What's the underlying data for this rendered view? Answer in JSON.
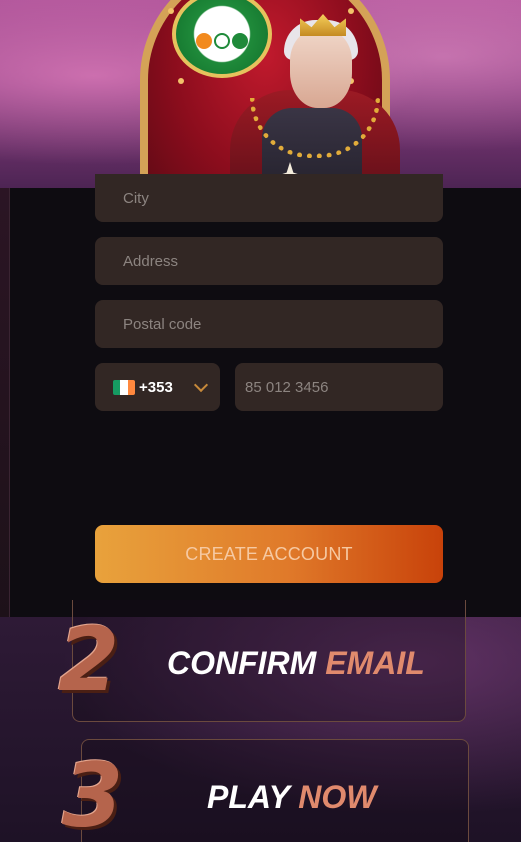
{
  "form": {
    "city_placeholder": "City",
    "address_placeholder": "Address",
    "postal_placeholder": "Postal code",
    "country": {
      "flag": "ireland-flag-icon",
      "dial_code": "+353"
    },
    "phone_placeholder": "85 012 3456",
    "create_account_label": "CREATE ACCOUNT"
  },
  "steps": [
    {
      "number": "2",
      "title_white": "CONFIRM",
      "title_accent": "EMAIL"
    },
    {
      "number": "3",
      "title_white": "PLAY",
      "title_accent": "NOW"
    }
  ],
  "colors": {
    "field_bg": "#322724",
    "panel_bg": "#0e0c11",
    "button_gradient_start": "#e8a23c",
    "button_gradient_end": "#c8420a",
    "accent_text": "#e08a6d"
  }
}
